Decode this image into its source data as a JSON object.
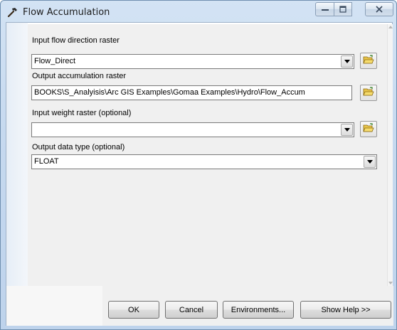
{
  "window": {
    "title": "Flow Accumulation",
    "icon": "hammer-icon"
  },
  "titlebar_buttons": {
    "minimize": "minimize-icon",
    "maximize": "maximize-icon",
    "close": "close-icon"
  },
  "form": {
    "input_flow_direction": {
      "label": "Input flow direction raster",
      "value": "Flow_Direct"
    },
    "output_accumulation": {
      "label": "Output accumulation raster",
      "value": "BOOKS\\S_Analyisis\\Arc GIS Examples\\Gomaa Examples\\Hydro\\Flow_Accum"
    },
    "input_weight": {
      "label": "Input weight raster (optional)",
      "value": ""
    },
    "output_data_type": {
      "label": "Output data type (optional)",
      "value": "FLOAT"
    }
  },
  "buttons": {
    "ok": "OK",
    "cancel": "Cancel",
    "environments": "Environments...",
    "show_help": "Show Help >>"
  }
}
